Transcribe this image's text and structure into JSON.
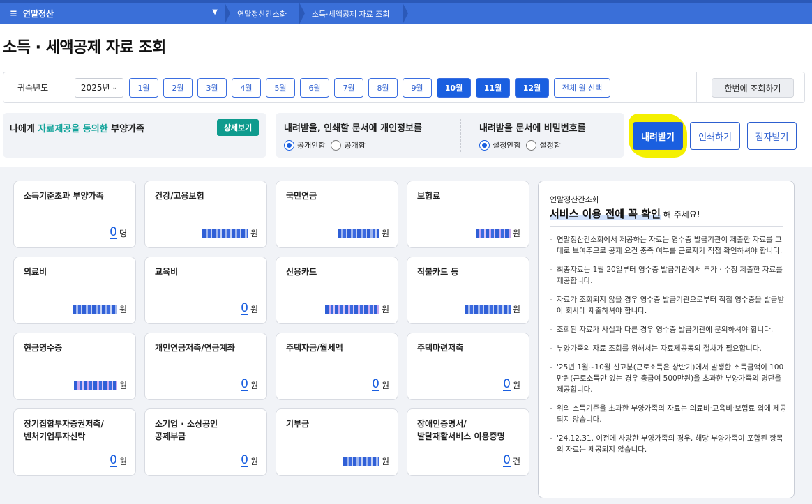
{
  "topbar": {
    "menu_label": "연말정산",
    "breadcrumbs": [
      "연말정산간소화",
      "소득·세액공제 자료 조회"
    ]
  },
  "page_title": "소득 · 세액공제 자료 조회",
  "filter": {
    "year_label": "귀속년도",
    "year_value": "2025년",
    "months": [
      {
        "label": "1월",
        "selected": false
      },
      {
        "label": "2월",
        "selected": false
      },
      {
        "label": "3월",
        "selected": false
      },
      {
        "label": "4월",
        "selected": false
      },
      {
        "label": "5월",
        "selected": false
      },
      {
        "label": "6월",
        "selected": false
      },
      {
        "label": "7월",
        "selected": false
      },
      {
        "label": "8월",
        "selected": false
      },
      {
        "label": "9월",
        "selected": false
      },
      {
        "label": "10월",
        "selected": true
      },
      {
        "label": "11월",
        "selected": true
      },
      {
        "label": "12월",
        "selected": true
      }
    ],
    "select_all_label": "전체 월 선택",
    "query_all_label": "한번에 조회하기"
  },
  "dependents": {
    "text_pre": "나에게 ",
    "text_hl": "자료제공을 동의한",
    "text_post": " 부양가족",
    "detail_label": "상세보기"
  },
  "options": {
    "personal_info": {
      "title": "내려받을, 인쇄할 문서에 개인정보를",
      "opt1": "공개안함",
      "opt2": "공개함",
      "selected": "공개안함"
    },
    "password": {
      "title": "내려받을 문서에 비밀번호를",
      "opt1": "설정안함",
      "opt2": "설정함",
      "selected": "설정안함"
    }
  },
  "actions": {
    "download": "내려받기",
    "print": "인쇄하기",
    "braille": "점자받기"
  },
  "cards": [
    {
      "title": "소득기준초과 부양가족",
      "value": "0",
      "unit": "명",
      "masked": false
    },
    {
      "title": "건강/고용보험",
      "value": "",
      "unit": "원",
      "masked": true
    },
    {
      "title": "국민연금",
      "value": "",
      "unit": "원",
      "masked": true
    },
    {
      "title": "보험료",
      "value": "",
      "unit": "원",
      "masked": true
    },
    {
      "title": "의료비",
      "value": "",
      "unit": "원",
      "masked": true
    },
    {
      "title": "교육비",
      "value": "0",
      "unit": "원",
      "masked": false
    },
    {
      "title": "신용카드",
      "value": "",
      "unit": "원",
      "masked": true
    },
    {
      "title": "직불카드 등",
      "value": "",
      "unit": "원",
      "masked": true
    },
    {
      "title": "현금영수증",
      "value": "",
      "unit": "원",
      "masked": true
    },
    {
      "title": "개인연금저축/연금계좌",
      "value": "0",
      "unit": "원",
      "masked": false
    },
    {
      "title": "주택자금/월세액",
      "value": "0",
      "unit": "원",
      "masked": false
    },
    {
      "title": "주택마련저축",
      "value": "0",
      "unit": "원",
      "masked": false
    },
    {
      "title": "장기집합투자증권저축/\n벤처기업투자신탁",
      "value": "0",
      "unit": "원",
      "masked": false
    },
    {
      "title": "소기업 · 소상공인\n공제부금",
      "value": "0",
      "unit": "원",
      "masked": false
    },
    {
      "title": "기부금",
      "value": "",
      "unit": "원",
      "masked": true
    },
    {
      "title": "장애인증명서/\n발달재활서비스 이용증명",
      "value": "0",
      "unit": "건",
      "masked": false
    }
  ],
  "notice": {
    "sub": "연말정산간소화",
    "head_hl": "서비스 이용 전에 꼭 확인",
    "head_tail": "해 주세요!",
    "items": [
      "연말정산간소화에서 제공하는 자료는 영수증 발급기관이 제출한 자료를 그대로 보여주므로 공제 요건 충족 여부를 근로자가 직접 확인하셔야 합니다.",
      "최종자료는 1월 20일부터 영수증 발급기관에서 추가 · 수정 제출한 자료를 제공합니다.",
      "자료가 조회되지 않을 경우 영수증 발급기관으로부터 직접 영수증을 발급받아 회사에 제출하셔야 합니다.",
      "조회된 자료가 사실과 다른 경우 영수증 발급기관에 문의하셔야 합니다.",
      "부양가족의 자료 조회를 위해서는 자료제공동의 절차가 필요합니다.",
      "'25년 1월~10월 신고분(근로소득은 상반기)에서 발생한 소득금액이 100만원(근로소득만 있는 경우 총급여 500만원)을 초과한 부양가족의 명단을 제공합니다.",
      "위의 소득기준을 초과한 부양가족의 자료는 의료비·교육비·보험료 외에 제공되지 않습니다.",
      "'24.12.31. 이전에 사망한 부양가족의 경우, 해당 부양가족이 포함된 항목의 자료는 제공되지 않습니다."
    ]
  }
}
